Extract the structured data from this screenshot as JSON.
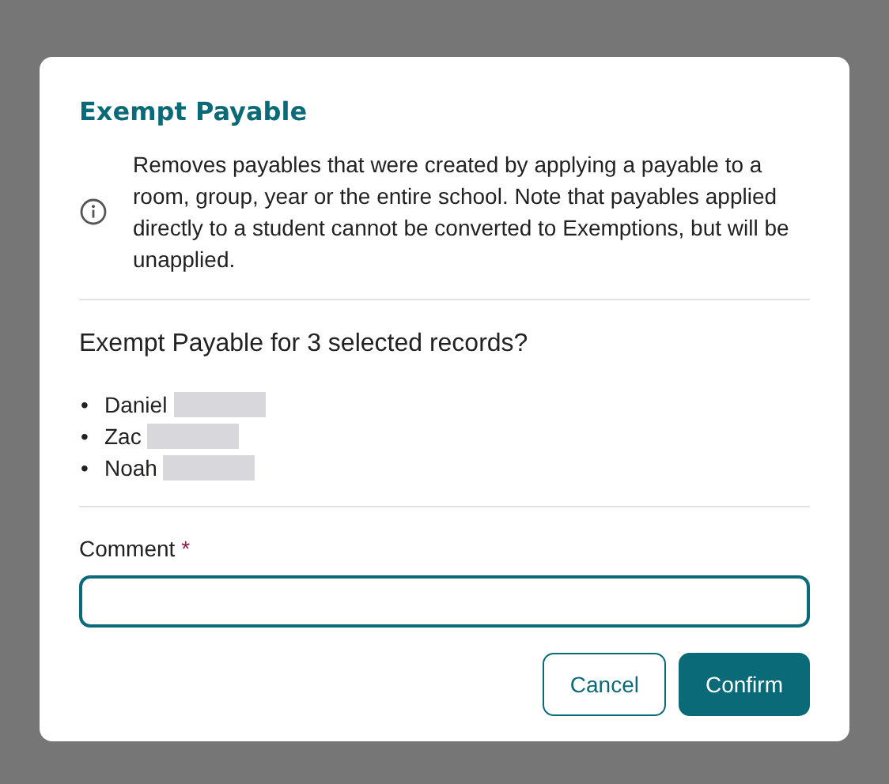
{
  "dialog": {
    "title": "Exempt Payable",
    "info": "Removes payables that were created by applying a payable to a room, group, year or the entire school. Note that payables applied directly to a student cannot be converted to Exemptions, but will be unapplied.",
    "question": "Exempt Payable for 3 selected records?",
    "records": [
      {
        "bullet": "•",
        "name": "Daniel",
        "redacted": true
      },
      {
        "bullet": "•",
        "name": "Zac",
        "redacted": true
      },
      {
        "bullet": "•",
        "name": "Noah",
        "redacted": true
      }
    ],
    "comment": {
      "label": "Comment",
      "required_mark": "*",
      "focused": true
    },
    "buttons": [
      {
        "label": "Cancel",
        "kind": "secondary"
      },
      {
        "label": "Confirm",
        "kind": "primary"
      }
    ]
  }
}
